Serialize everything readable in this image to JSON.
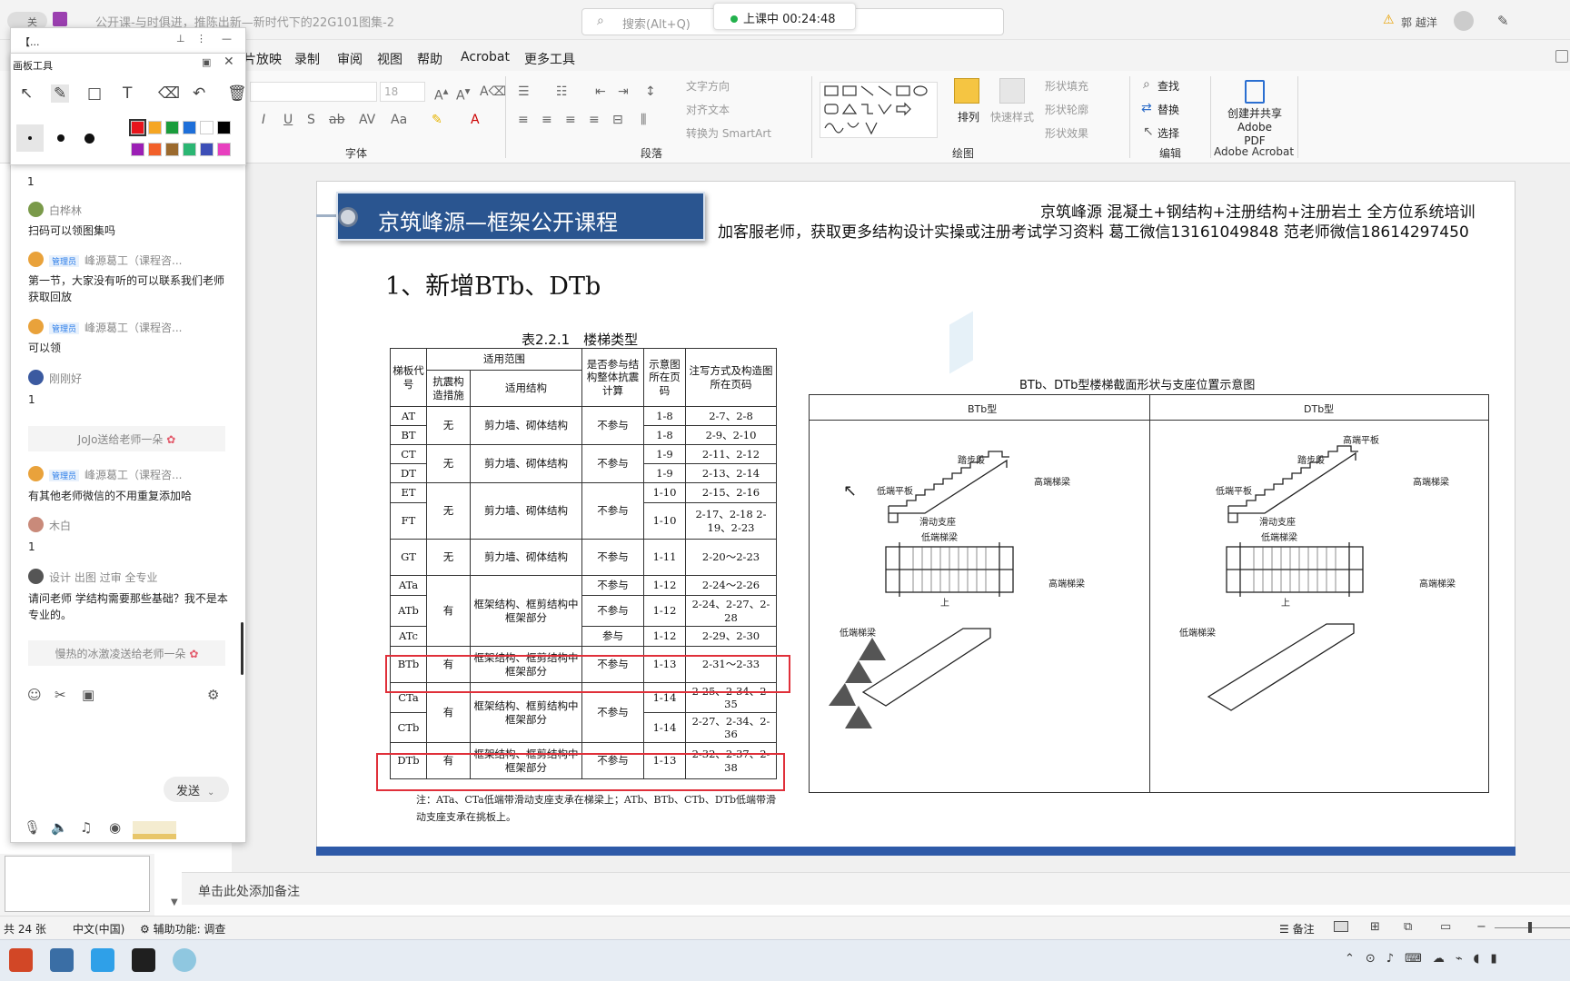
{
  "app": {
    "doc_title": "公开课-与时俱进，推陈出新—新时代下的22G101图集-2",
    "autosave_label": "关",
    "search_placeholder": "搜索(Alt+Q)",
    "class_timer": "上课中 00:24:48",
    "user_name": "郭 越洋"
  },
  "menu": [
    "片放映",
    "录制",
    "审阅",
    "视图",
    "帮助",
    "Acrobat",
    "更多工具"
  ],
  "ribbon": {
    "font_size": "18",
    "groups": {
      "font": "字体",
      "paragraph": "段落",
      "drawing": "绘图",
      "edit": "编辑",
      "acrobat": "Adobe Acrobat"
    },
    "para_items": [
      "文字方向",
      "对齐文本",
      "转换为 SmartArt"
    ],
    "drawing_items": [
      "排列",
      "快速样式",
      "形状填充",
      "形状轮廓",
      "形状效果"
    ],
    "edit_items": [
      "查找",
      "替换",
      "选择"
    ],
    "acrobat_btn": [
      "创建并共享",
      "Adobe PDF"
    ]
  },
  "slide": {
    "banner": "京筑峰源—框架公开课程",
    "promo_line1": "京筑峰源 混凝土+钢结构+注册结构+注册岩土 全方位系统培训",
    "promo_line2": "加客服老师，获取更多结构设计实操或注册考试学习资料 葛工微信13161049848 范老师微信18614297450",
    "heading": "1、新增BTb、DTb",
    "table_caption": "表2.2.1　楼梯类型",
    "table_headers": {
      "code": "梯板代号",
      "scope": "适用范围",
      "seismic": "抗震构造措施",
      "structure": "适用结构",
      "participate": "是否参与结构整体抗震计算",
      "page": "示意图所在页码",
      "note_page": "注写方式及构造图所在页码"
    },
    "table_rows": [
      {
        "code": "AT",
        "seismic": "无",
        "structure": "剪力墙、砌体结构",
        "part": "不参与",
        "page": "1-8",
        "note": "2-7、2-8"
      },
      {
        "code": "BT",
        "page": "1-8",
        "note": "2-9、2-10"
      },
      {
        "code": "CT",
        "seismic": "无",
        "structure": "剪力墙、砌体结构",
        "part": "不参与",
        "page": "1-9",
        "note": "2-11、2-12"
      },
      {
        "code": "DT",
        "page": "1-9",
        "note": "2-13、2-14"
      },
      {
        "code": "ET",
        "seismic": "无",
        "structure": "剪力墙、砌体结构",
        "part": "不参与",
        "page": "1-10",
        "note": "2-15、2-16"
      },
      {
        "code": "FT",
        "page": "1-10",
        "note": "2-17、2-18 2-19、2-23"
      },
      {
        "code": "GT",
        "seismic": "无",
        "structure": "剪力墙、砌体结构",
        "part": "不参与",
        "page": "1-11",
        "note": "2-20～2-23"
      },
      {
        "code": "ATa",
        "seismic": "有",
        "structure": "框架结构、框剪结构中框架部分",
        "part": "不参与",
        "page": "1-12",
        "note": "2-24～2-26"
      },
      {
        "code": "ATb",
        "part": "不参与",
        "page": "1-12",
        "note": "2-24、2-27、2-28"
      },
      {
        "code": "ATc",
        "part": "参与",
        "page": "1-12",
        "note": "2-29、2-30"
      },
      {
        "code": "BTb",
        "seismic": "有",
        "structure": "框架结构、框剪结构中框架部分",
        "part": "不参与",
        "page": "1-13",
        "note": "2-31～2-33"
      },
      {
        "code": "CTa",
        "seismic": "有",
        "structure": "框架结构、框剪结构中框架部分",
        "part": "不参与",
        "page": "1-14",
        "note": "2-25、2-34、2-35"
      },
      {
        "code": "CTb",
        "page": "1-14",
        "note": "2-27、2-34、2-36"
      },
      {
        "code": "DTb",
        "seismic": "有",
        "structure": "框架结构、框剪结构中框架部分",
        "part": "不参与",
        "page": "1-13",
        "note": "2-32、2-37、2-38"
      }
    ],
    "table_note": "注：ATa、CTa低端带滑动支座支承在梯梁上；ATb、BTb、CTb、DTb低端带滑动支座支承在挑板上。",
    "figure_title": "BTb、DTb型楼梯截面形状与支座位置示意图",
    "figure_left": "BTb型",
    "figure_right": "DTb型",
    "labels": {
      "step": "踏步段",
      "high_beam": "高端梯梁",
      "low_slab": "低端平板",
      "slide": "滑动支座",
      "low_beam": "低端梯梁",
      "high_slab": "高端平板",
      "up": "上"
    }
  },
  "notes_placeholder": "单击此处添加备注",
  "status": {
    "slides": "共 24 张",
    "lang": "中文(中国)",
    "access": "辅助功能: 调查",
    "notes_btn": "备注"
  },
  "chat": {
    "header": "【...",
    "messages": [
      {
        "name": "白桦林",
        "text": "扫码可以领图集吗",
        "admin": false
      },
      {
        "name": "峰源葛工（课程咨...",
        "text": "第一节，大家没有听的可以联系我们老师获取回放",
        "admin": true
      },
      {
        "name": "峰源葛工（课程咨...",
        "text": "可以领",
        "admin": true
      },
      {
        "name": "刚刚好",
        "text": "1",
        "admin": false
      },
      {
        "name": "峰源葛工（课程咨...",
        "text": "有其他老师微信的不用重复添加哈",
        "admin": true
      },
      {
        "name": "木白",
        "text": "1",
        "admin": false
      },
      {
        "name": "设计 出图 过审 全专业",
        "text": "请问老师 学结构需要那些基础？我不是本专业的。",
        "admin": false
      }
    ],
    "admin_badge": "管理员",
    "gift1": "JoJo送给老师一朵",
    "gift2": "慢热的冰激凌送给老师一朵",
    "send": "发送",
    "first_line": "1"
  },
  "pen_tool": {
    "title": "画板工具",
    "colors": [
      "#e8141c",
      "#f5a623",
      "#1a9c3c",
      "#1e6fd9",
      "#ffffff",
      "#000000",
      "#9b1fb5",
      "#f2602a",
      "#9b6a2e",
      "#2bb673",
      "#3d4fb7",
      "#e83fbf"
    ]
  }
}
